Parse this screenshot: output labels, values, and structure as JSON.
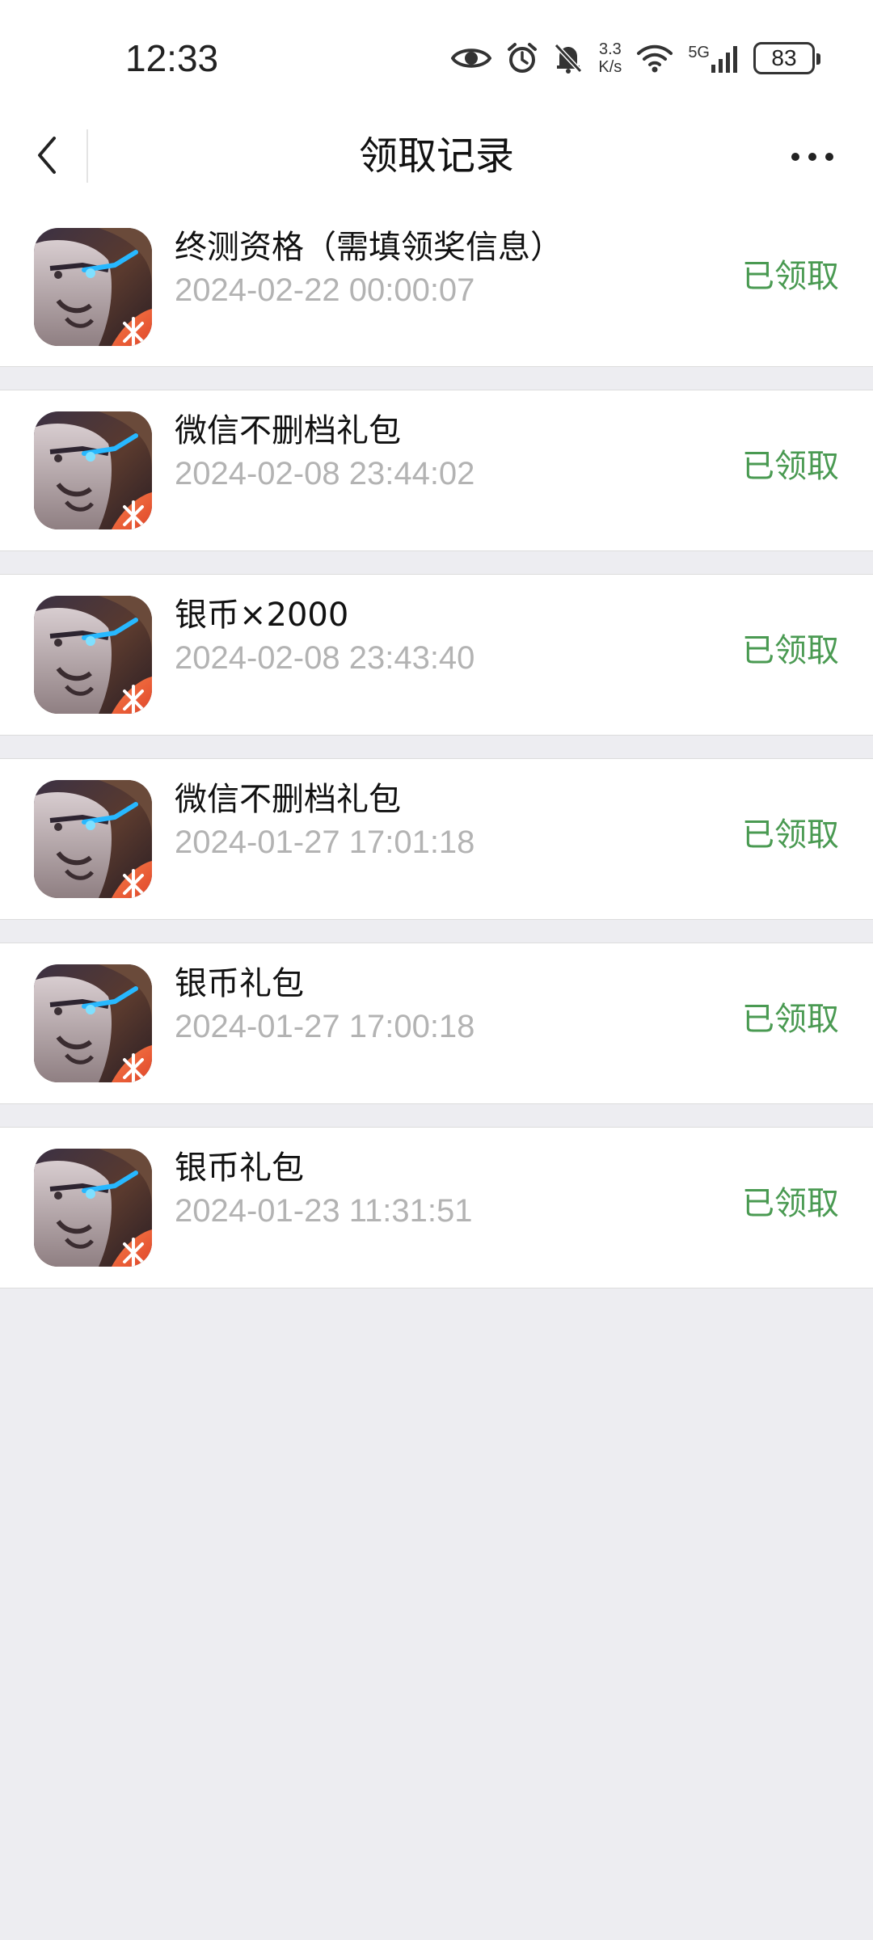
{
  "status_bar": {
    "time": "12:33",
    "net_speed_value": "3.3",
    "net_speed_unit": "K/s",
    "network_type": "5G",
    "battery": "83",
    "icons": [
      "eye-icon",
      "alarm-icon",
      "bell-mute-icon",
      "wifi-icon",
      "signal-icon",
      "battery-icon"
    ]
  },
  "nav": {
    "title": "领取记录",
    "back_icon": "chevron-left-icon",
    "more_icon": "more-dots-icon"
  },
  "records": [
    {
      "title": "终测资格（需填领奖信息）",
      "time": "2024-02-22 00:00:07",
      "status": "已领取"
    },
    {
      "title": "微信不删档礼包",
      "time": "2024-02-08 23:44:02",
      "status": "已领取"
    },
    {
      "title": "银币×2000",
      "time": "2024-02-08 23:43:40",
      "status": "已领取"
    },
    {
      "title": "微信不删档礼包",
      "time": "2024-01-27 17:01:18",
      "status": "已领取"
    },
    {
      "title": "银币礼包",
      "time": "2024-01-27 17:00:18",
      "status": "已领取"
    },
    {
      "title": "银币礼包",
      "time": "2024-01-23 11:31:51",
      "status": "已领取"
    }
  ],
  "colors": {
    "status_claimed": "#4a9a52",
    "background": "#ededf1",
    "time_text": "#b3b3b3"
  }
}
